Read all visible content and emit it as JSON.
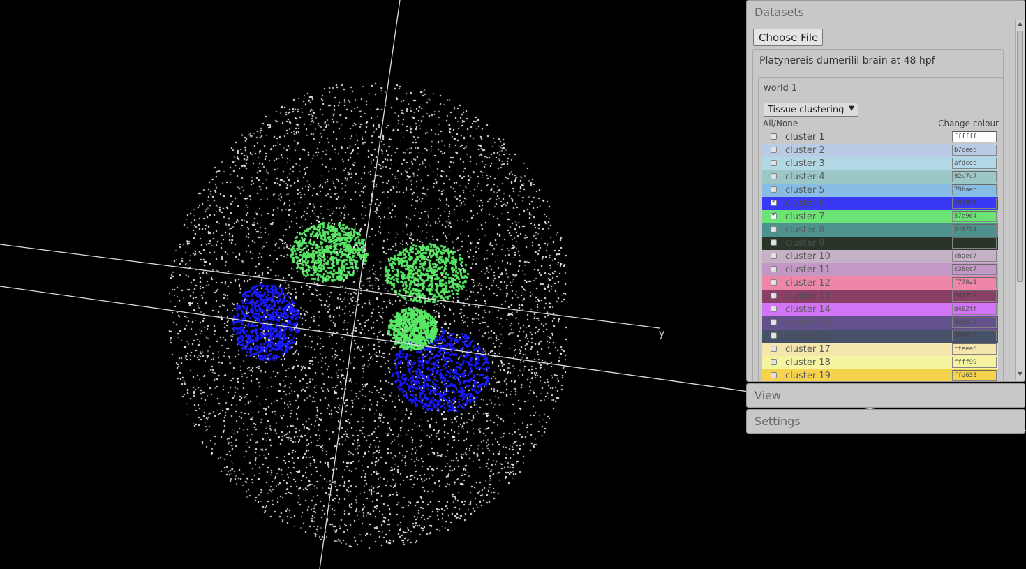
{
  "datasets_panel": {
    "title": "Datasets",
    "choose_file_label": "Choose File",
    "dataset_title": "Platynereis dumerilii brain at 48 hpf",
    "world_label": "world 1",
    "select_value": "Tissue clustering",
    "all_none_label": "All/None",
    "change_colour_label": "Change colour",
    "clusters": [
      {
        "label": "cluster 1",
        "color": "ffffff",
        "checked": false
      },
      {
        "label": "cluster 2",
        "color": "b7ceec",
        "checked": false
      },
      {
        "label": "cluster 3",
        "color": "afdcec",
        "checked": false
      },
      {
        "label": "cluster 4",
        "color": "92c7c7",
        "checked": false
      },
      {
        "label": "cluster 5",
        "color": "79baec",
        "checked": false
      },
      {
        "label": "cluster 6",
        "color": "1919ff",
        "checked": true
      },
      {
        "label": "cluster 7",
        "color": "57e964",
        "checked": true
      },
      {
        "label": "cluster 8",
        "color": "348781",
        "checked": false
      },
      {
        "label": "cluster 9",
        "color": "",
        "checked": false
      },
      {
        "label": "cluster 10",
        "color": "c6aec7",
        "checked": false
      },
      {
        "label": "cluster 11",
        "color": "c38ec7",
        "checked": false
      },
      {
        "label": "cluster 12",
        "color": "f778a1",
        "checked": false
      },
      {
        "label": "cluster 13",
        "color": "7d2252",
        "checked": false
      },
      {
        "label": "cluster 14",
        "color": "d462ff",
        "checked": false
      },
      {
        "label": "cluster 15",
        "color": "4e387e",
        "checked": false
      },
      {
        "label": "cluster 16",
        "color": "2b3856",
        "checked": false
      },
      {
        "label": "cluster 17",
        "color": "ffeea6",
        "checked": false
      },
      {
        "label": "cluster 18",
        "color": "ffff99",
        "checked": false
      },
      {
        "label": "cluster 19",
        "color": "ffd633",
        "checked": false
      }
    ]
  },
  "view_panel": {
    "title": "View"
  },
  "settings_panel": {
    "title": "Settings"
  },
  "viewer": {
    "axis_label_y": "y",
    "background_color": "#000000",
    "point_color": "#ffffff",
    "highlight_colors": [
      "#1919ff",
      "#57e964"
    ]
  }
}
